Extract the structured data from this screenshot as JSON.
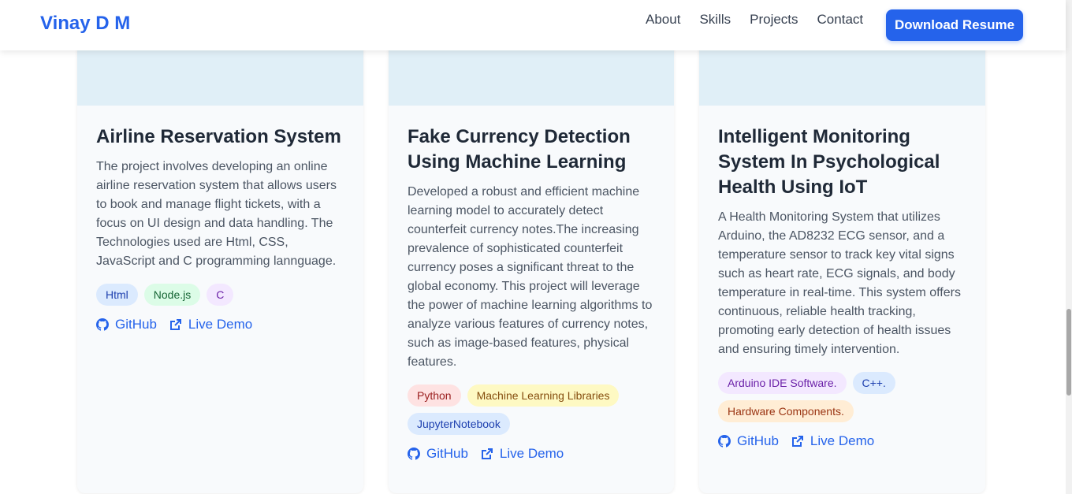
{
  "header": {
    "brand": "Vinay D M",
    "nav": [
      "About",
      "Skills",
      "Projects",
      "Contact"
    ],
    "resume_button": "Download Resume"
  },
  "projects": [
    {
      "title": "Airline Reservation System",
      "description": "The project involves developing an online airline reservation system that allows users to book and manage flight tickets, with a focus on UI design and data handling. The Technologies used are Html, CSS, JavaScript and C programming lannguage.",
      "tags": [
        {
          "label": "Html",
          "color": "blue"
        },
        {
          "label": "Node.js",
          "color": "green"
        },
        {
          "label": "C",
          "color": "purple"
        }
      ],
      "github_label": "GitHub",
      "demo_label": "Live Demo"
    },
    {
      "title": "Fake Currency Detection Using Machine Learning",
      "description": "Developed a robust and efficient machine learning model to accurately detect counterfeit currency notes.The increasing prevalence of sophisticated counterfeit currency poses a significant threat to the global economy. This project will leverage the power of machine learning algorithms to analyze various features of currency notes, such as image-based features, physical features.",
      "tags": [
        {
          "label": "Python",
          "color": "red"
        },
        {
          "label": "Machine Learning Libraries",
          "color": "yellow"
        },
        {
          "label": "JupyterNotebook",
          "color": "blue"
        }
      ],
      "github_label": "GitHub",
      "demo_label": "Live Demo"
    },
    {
      "title": "Intelligent Monitoring System In Psychological Health Using IoT",
      "description": "A Health Monitoring System that utilizes Arduino, the AD8232 ECG sensor, and a temperature sensor to track key vital signs such as heart rate, ECG signals, and body temperature in real-time. This system offers continuous, reliable health tracking, promoting early detection of health issues and ensuring timely intervention.",
      "tags": [
        {
          "label": "Arduino IDE Software.",
          "color": "purple"
        },
        {
          "label": "C++.",
          "color": "blue"
        },
        {
          "label": "Hardware Components.",
          "color": "orange"
        }
      ],
      "github_label": "GitHub",
      "demo_label": "Live Demo"
    }
  ],
  "colors": {
    "accent": "#2563eb",
    "card_bg": "#f8fafc",
    "card_image": "#e0eff7"
  }
}
